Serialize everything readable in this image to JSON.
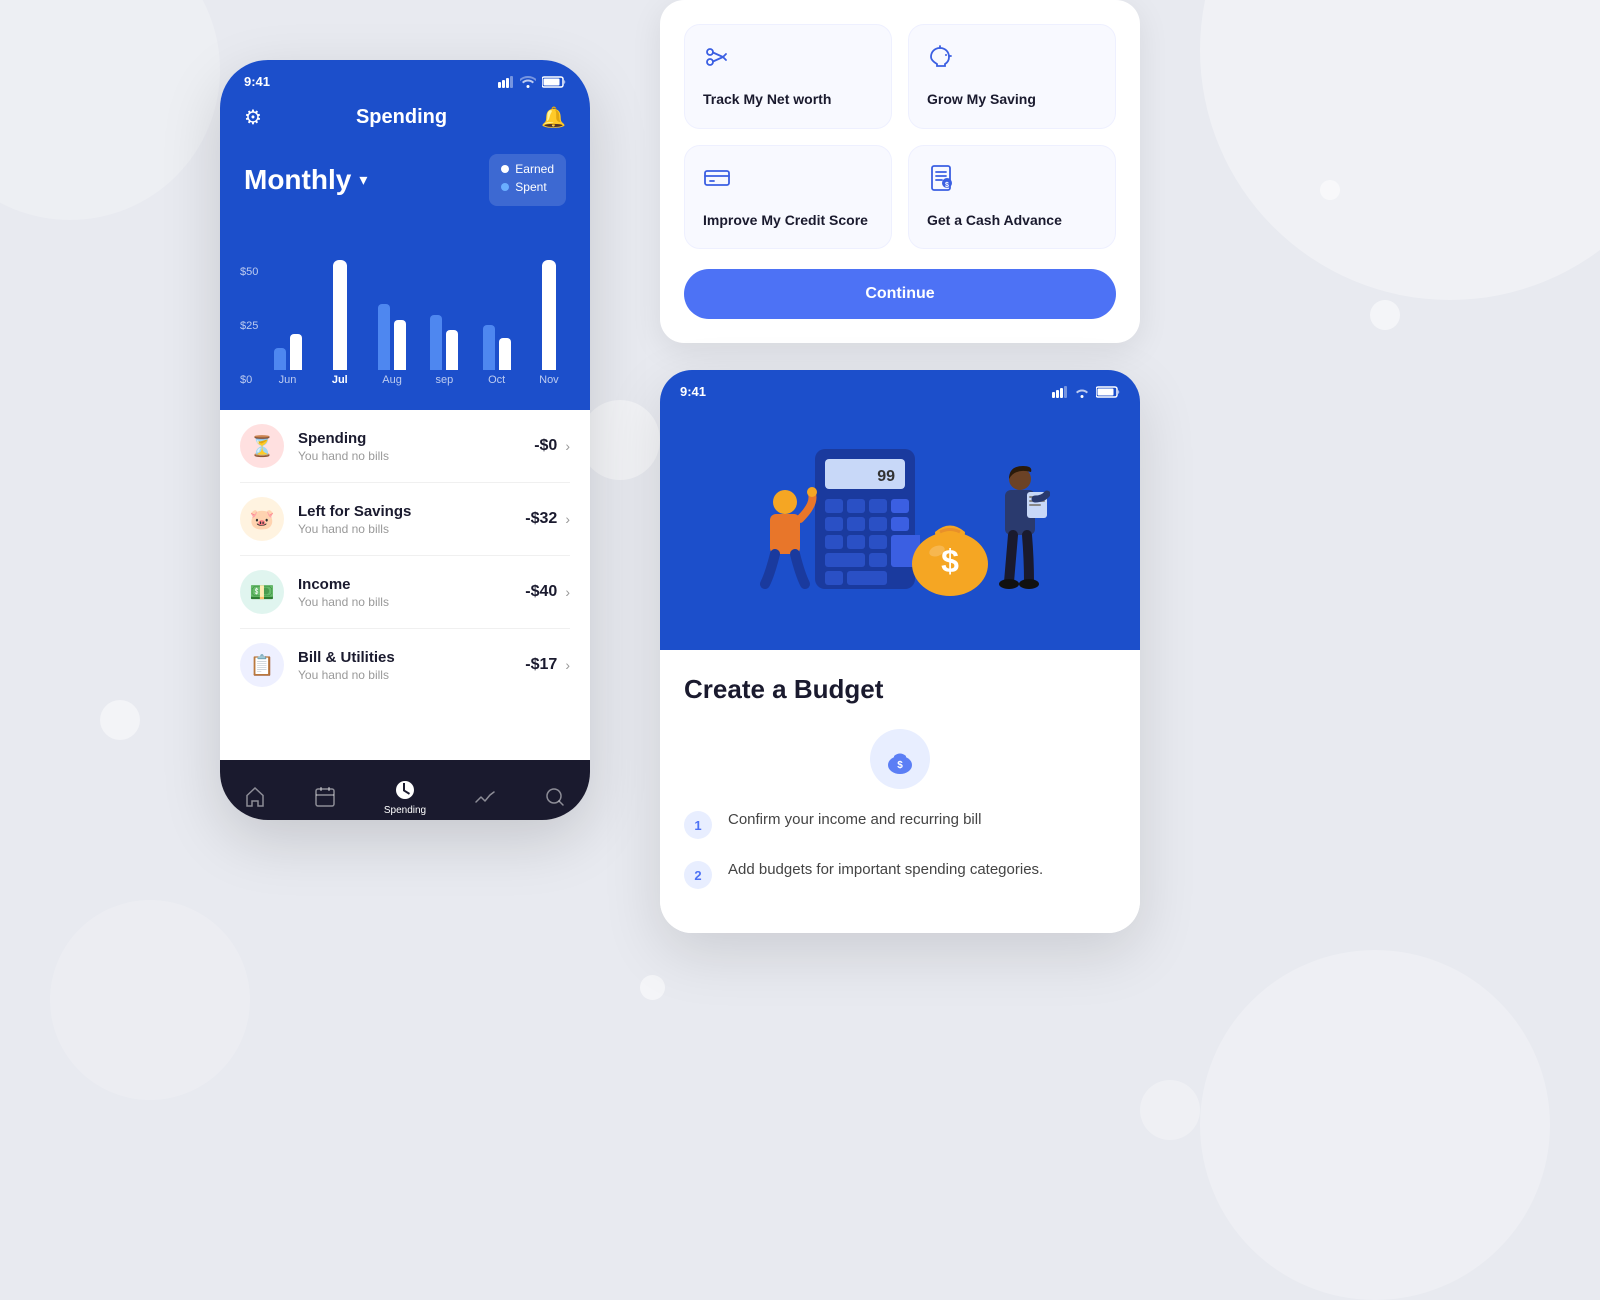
{
  "background": {
    "color": "#e8eaf0"
  },
  "phone_left": {
    "status_bar": {
      "time": "9:41",
      "signal": "▌▌▌",
      "wifi": "wifi",
      "battery": "battery"
    },
    "header": {
      "title": "Spending",
      "settings_icon": "⚙",
      "bell_icon": "🔔"
    },
    "monthly": {
      "label": "Monthly",
      "dropdown_icon": "▾"
    },
    "legend": {
      "earned_label": "Earned",
      "spent_label": "Spent",
      "earned_color": "#ffffff",
      "spent_color": "#6aaeff"
    },
    "chart": {
      "y_labels": [
        "$0",
        "$25",
        "$50"
      ],
      "bars": [
        {
          "month": "Jun",
          "active": false,
          "white_h": 40,
          "blue_h": 20
        },
        {
          "month": "Jul",
          "active": true,
          "white_h": 110,
          "blue_h": 0
        },
        {
          "month": "Aug",
          "active": false,
          "white_h": 55,
          "blue_h": 70
        },
        {
          "month": "sep",
          "active": false,
          "white_h": 45,
          "blue_h": 60
        },
        {
          "month": "Oct",
          "active": false,
          "white_h": 35,
          "blue_h": 50
        },
        {
          "month": "Nov",
          "active": false,
          "white_h": 110,
          "blue_h": 0
        }
      ]
    },
    "expenses": [
      {
        "name": "Spending",
        "sub": "You hand no bills",
        "amount": "-$0",
        "icon": "⏳",
        "icon_bg": "#ffe0e0"
      },
      {
        "name": "Left for Savings",
        "sub": "You hand no bills",
        "amount": "-$32",
        "icon": "💰",
        "icon_bg": "#fff3e0"
      },
      {
        "name": "Income",
        "sub": "You hand no bills",
        "amount": "-$40",
        "icon": "💵",
        "icon_bg": "#e0f5ef"
      },
      {
        "name": "Bill & Utilities",
        "sub": "You hand no bills",
        "amount": "-$17",
        "icon": "📋",
        "icon_bg": "#eef0ff"
      }
    ],
    "bottom_nav": [
      {
        "icon": "🏠",
        "label": "",
        "active": false
      },
      {
        "icon": "📅",
        "label": "",
        "active": false
      },
      {
        "icon": "📊",
        "label": "Spending",
        "active": true
      },
      {
        "icon": "📈",
        "label": "",
        "active": false
      },
      {
        "icon": "🔍",
        "label": "",
        "active": false
      }
    ]
  },
  "goals_card": {
    "items": [
      {
        "icon": "✂",
        "text": "Track My Net worth"
      },
      {
        "icon": "🐷",
        "text": "Grow My Saving"
      },
      {
        "icon": "💳",
        "text": "Improve My Credit Score"
      },
      {
        "icon": "📄",
        "text": "Get a Cash Advance"
      }
    ],
    "continue_label": "Continue"
  },
  "phone_right": {
    "status_bar": {
      "time": "9:41"
    },
    "illustration_number": "99",
    "dollar_symbol": "$",
    "body": {
      "title": "Create a Budget",
      "bag_icon": "💰",
      "steps": [
        {
          "num": "1",
          "text": "Confirm your income and recurring bill"
        },
        {
          "num": "2",
          "text": "Add budgets for important spending  categories."
        }
      ]
    }
  }
}
